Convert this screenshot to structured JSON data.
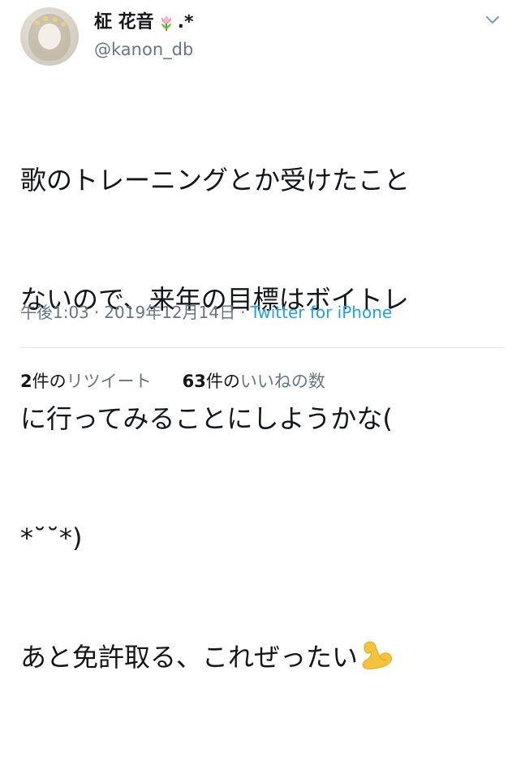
{
  "tweet": {
    "display_name": "柾 花音",
    "name_emoji": "tulip",
    "name_suffix": ".*",
    "handle": "@kanon_db",
    "menu_icon": "chevron-down-icon",
    "body_lines": [
      "歌のトレーニングとか受けたこと",
      "ないので、来年の目標はボイトレ",
      "に行ってみることにしようかな(",
      "*˘˘*)",
      "あと免許取る、これぜったい"
    ],
    "body_emoji": "flexed-biceps",
    "time": "午後1:03",
    "separator": "·",
    "date": "2019年12月14日",
    "source": "Twitter for iPhone",
    "retweets": {
      "count": "2",
      "unit": "件の",
      "label": "リツイート"
    },
    "likes": {
      "count": "63",
      "unit": "件の",
      "label": "いいねの数"
    }
  },
  "colors": {
    "text": "#14171a",
    "secondary": "#657786",
    "link": "#1da1f2",
    "divider": "#e1e8ed",
    "emoji_yellow": "#f5c33b"
  }
}
